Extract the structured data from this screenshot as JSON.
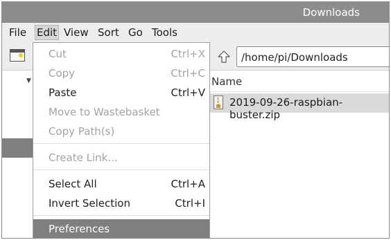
{
  "window": {
    "title": "Downloads"
  },
  "menubar": {
    "items": [
      "File",
      "Edit",
      "View",
      "Sort",
      "Go",
      "Tools"
    ],
    "active": "Edit"
  },
  "toolbar": {
    "path_value": "/home/pi/Downloads"
  },
  "file_list": {
    "column_header": "Name",
    "files": [
      "2019-09-26-raspbian-buster.zip"
    ]
  },
  "edit_menu": {
    "items": [
      {
        "label": "Cut",
        "shortcut": "Ctrl+X",
        "enabled": false
      },
      {
        "label": "Copy",
        "shortcut": "Ctrl+C",
        "enabled": false
      },
      {
        "label": "Paste",
        "shortcut": "Ctrl+V",
        "enabled": true
      },
      {
        "label": "Move to Wastebasket",
        "shortcut": "",
        "enabled": false
      },
      {
        "label": "Copy Path(s)",
        "shortcut": "",
        "enabled": false
      },
      {
        "label": "Create Link...",
        "shortcut": "",
        "enabled": false
      },
      {
        "label": "Select All",
        "shortcut": "Ctrl+A",
        "enabled": true
      },
      {
        "label": "Invert Selection",
        "shortcut": "Ctrl+I",
        "enabled": true
      },
      {
        "label": "Preferences",
        "shortcut": "",
        "enabled": true,
        "highlighted": true
      }
    ]
  },
  "colors": {
    "titlebar": "#8d8d8d",
    "menu_highlight": "#7f7f7f",
    "disabled_text": "#a3a3a3"
  }
}
